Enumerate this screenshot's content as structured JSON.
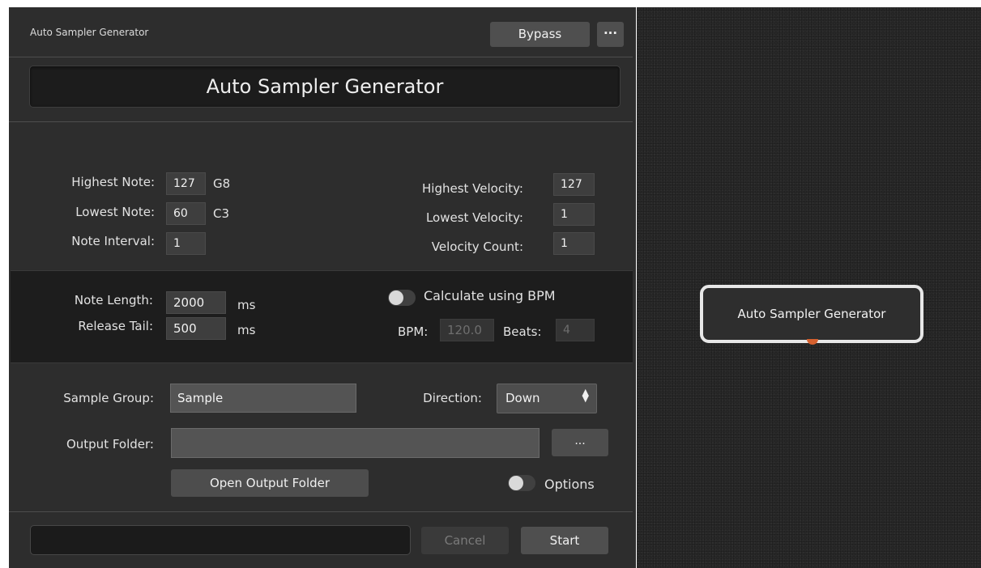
{
  "window": {
    "title": "Auto Sampler Generator"
  },
  "toolbar": {
    "bypass_label": "Bypass",
    "more_label": "···"
  },
  "header": {
    "title": "Auto Sampler Generator"
  },
  "notes": {
    "highest_label": "Highest Note:",
    "highest_value": "127",
    "highest_name": "G8",
    "lowest_label": "Lowest Note:",
    "lowest_value": "60",
    "lowest_name": "C3",
    "interval_label": "Note Interval:",
    "interval_value": "1"
  },
  "velocity": {
    "highest_label": "Highest Velocity:",
    "highest_value": "127",
    "lowest_label": "Lowest Velocity:",
    "lowest_value": "1",
    "count_label": "Velocity Count:",
    "count_value": "1"
  },
  "timing": {
    "note_length_label": "Note Length:",
    "note_length_value": "2000",
    "note_length_unit": "ms",
    "release_tail_label": "Release Tail:",
    "release_tail_value": "500",
    "release_tail_unit": "ms",
    "bpm_toggle_label": "Calculate using BPM",
    "bpm_toggle_on": false,
    "bpm_label": "BPM:",
    "bpm_value": "120.0",
    "beats_label": "Beats:",
    "beats_value": "4"
  },
  "output": {
    "sample_group_label": "Sample Group:",
    "sample_group_value": "Sample",
    "direction_label": "Direction:",
    "direction_value": "Down",
    "output_folder_label": "Output Folder:",
    "output_folder_value": "",
    "browse_label": "...",
    "open_folder_label": "Open Output Folder",
    "options_label": "Options",
    "options_on": false
  },
  "footer": {
    "cancel_label": "Cancel",
    "start_label": "Start"
  },
  "graph": {
    "node_label": "Auto Sampler Generator",
    "port_color": "#d6612f"
  }
}
